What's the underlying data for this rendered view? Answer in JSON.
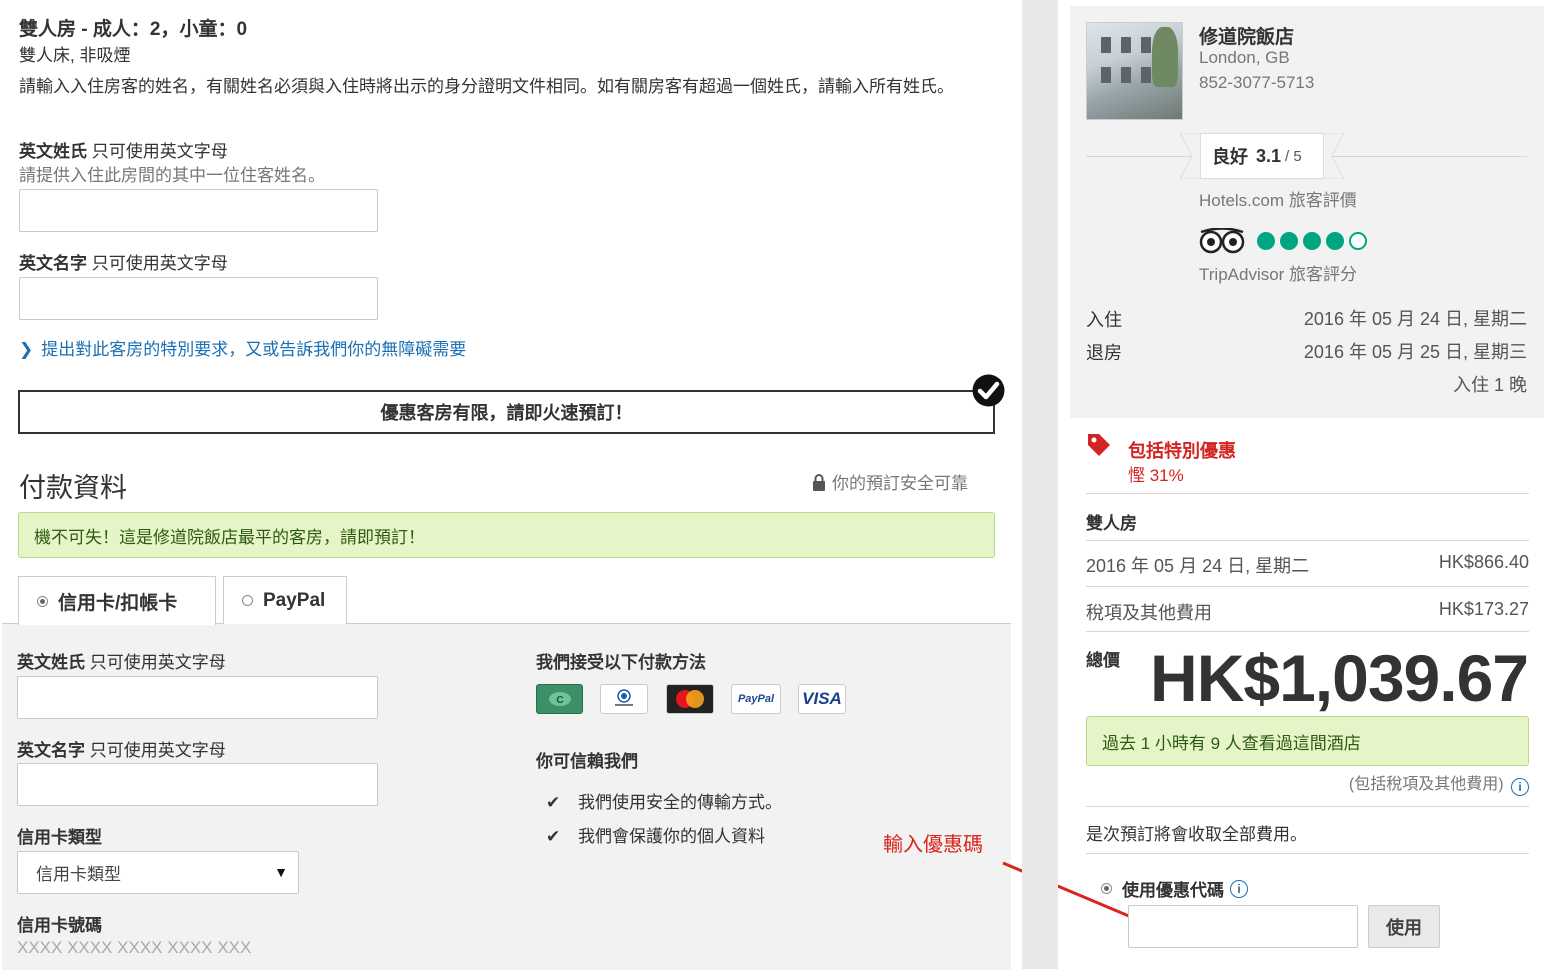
{
  "room": {
    "title": "雙人房 - 成人：2，小童：0",
    "details": "雙人床, 非吸煙",
    "instructions": "請輸入入住房客的姓名，有關姓名必須與入住時將出示的身分證明文件相同。如有關房客有超過一個姓氏，請輸入所有姓氏。",
    "lastname_label": "英文姓氏",
    "lastname_hint": "只可使用英文字母",
    "lastname_sub": "請提供入住此房間的其中一位住客姓名。",
    "firstname_label": "英文名字",
    "firstname_hint": "只可使用英文字母",
    "special_request_link": "提出對此客房的特別要求，又或告訴我們你的無障礙需要"
  },
  "urgency_banner": "優惠客房有限，請即火速預訂！",
  "payment": {
    "heading": "付款資料",
    "secure_text": "你的預訂安全可靠",
    "best_price_banner": "機不可失！這是修道院飯店最平的客房，請即預訂！",
    "tabs": [
      {
        "label": "信用卡/扣帳卡",
        "selected": true
      },
      {
        "label": "PayPal",
        "selected": false
      }
    ],
    "lastname_label": "英文姓氏",
    "lastname_hint": "只可使用英文字母",
    "firstname_label": "英文名字",
    "firstname_hint": "只可使用英文字母",
    "card_type_label": "信用卡類型",
    "card_type_selected": "信用卡類型",
    "card_number_label": "信用卡號碼",
    "card_number_placeholder": "XXXX XXXX XXXX XXXX XXX",
    "accepted_heading": "我們接受以下付款方法",
    "trust_heading": "你可信賴我們",
    "trust_items": [
      "我們使用安全的傳輸方式。",
      "我們會保護你的個人資料"
    ],
    "card_logos": [
      "jcb-icon",
      "diners-club-icon",
      "mastercard-icon",
      "paypal-icon",
      "visa-icon"
    ],
    "paypal_logo_text": "PayPal",
    "visa_logo_text": "VISA"
  },
  "annotation": {
    "text": "輸入優惠碼",
    "color": "#d9261c"
  },
  "hotel": {
    "name": "修道院飯店",
    "location": "London, GB",
    "phone": "852-3077-5713",
    "rating_word": "良好",
    "rating_value": "3.1",
    "rating_scale": "/ 5",
    "rating_source": "Hotels.com 旅客評價",
    "tripadvisor_bubbles": 4,
    "tripadvisor_label": "TripAdvisor 旅客評分",
    "checkin_label": "入住",
    "checkin_date": "2016 年 05 月 24 日, 星期二",
    "checkout_label": "退房",
    "checkout_date": "2016 年 05 月 25 日, 星期三",
    "nights": "入住 1 晚"
  },
  "summary": {
    "offer_title": "包括特別優惠",
    "offer_discount": "慳 31%",
    "room_type": "雙人房",
    "night_date": "2016 年 05 月 24 日, 星期二",
    "night_price": "HK$866.40",
    "taxes_label": "稅項及其他費用",
    "taxes_price": "HK$173.27",
    "total_label": "總價",
    "total_price": "HK$1,039.67",
    "views_banner": "過去 1 小時有 9 人查看過這間酒店",
    "tax_note": "(包括稅項及其他費用)",
    "full_charge_note": "是次預訂將會收取全部費用。",
    "coupon_label": "使用優惠代碼",
    "coupon_button": "使用"
  },
  "colors": {
    "link_blue": "#1a6fb5",
    "offer_red": "#d32323",
    "banner_green_bg": "#e6f5c7",
    "banner_green_border": "#b9d98a",
    "tripadvisor_green": "#00a680"
  }
}
